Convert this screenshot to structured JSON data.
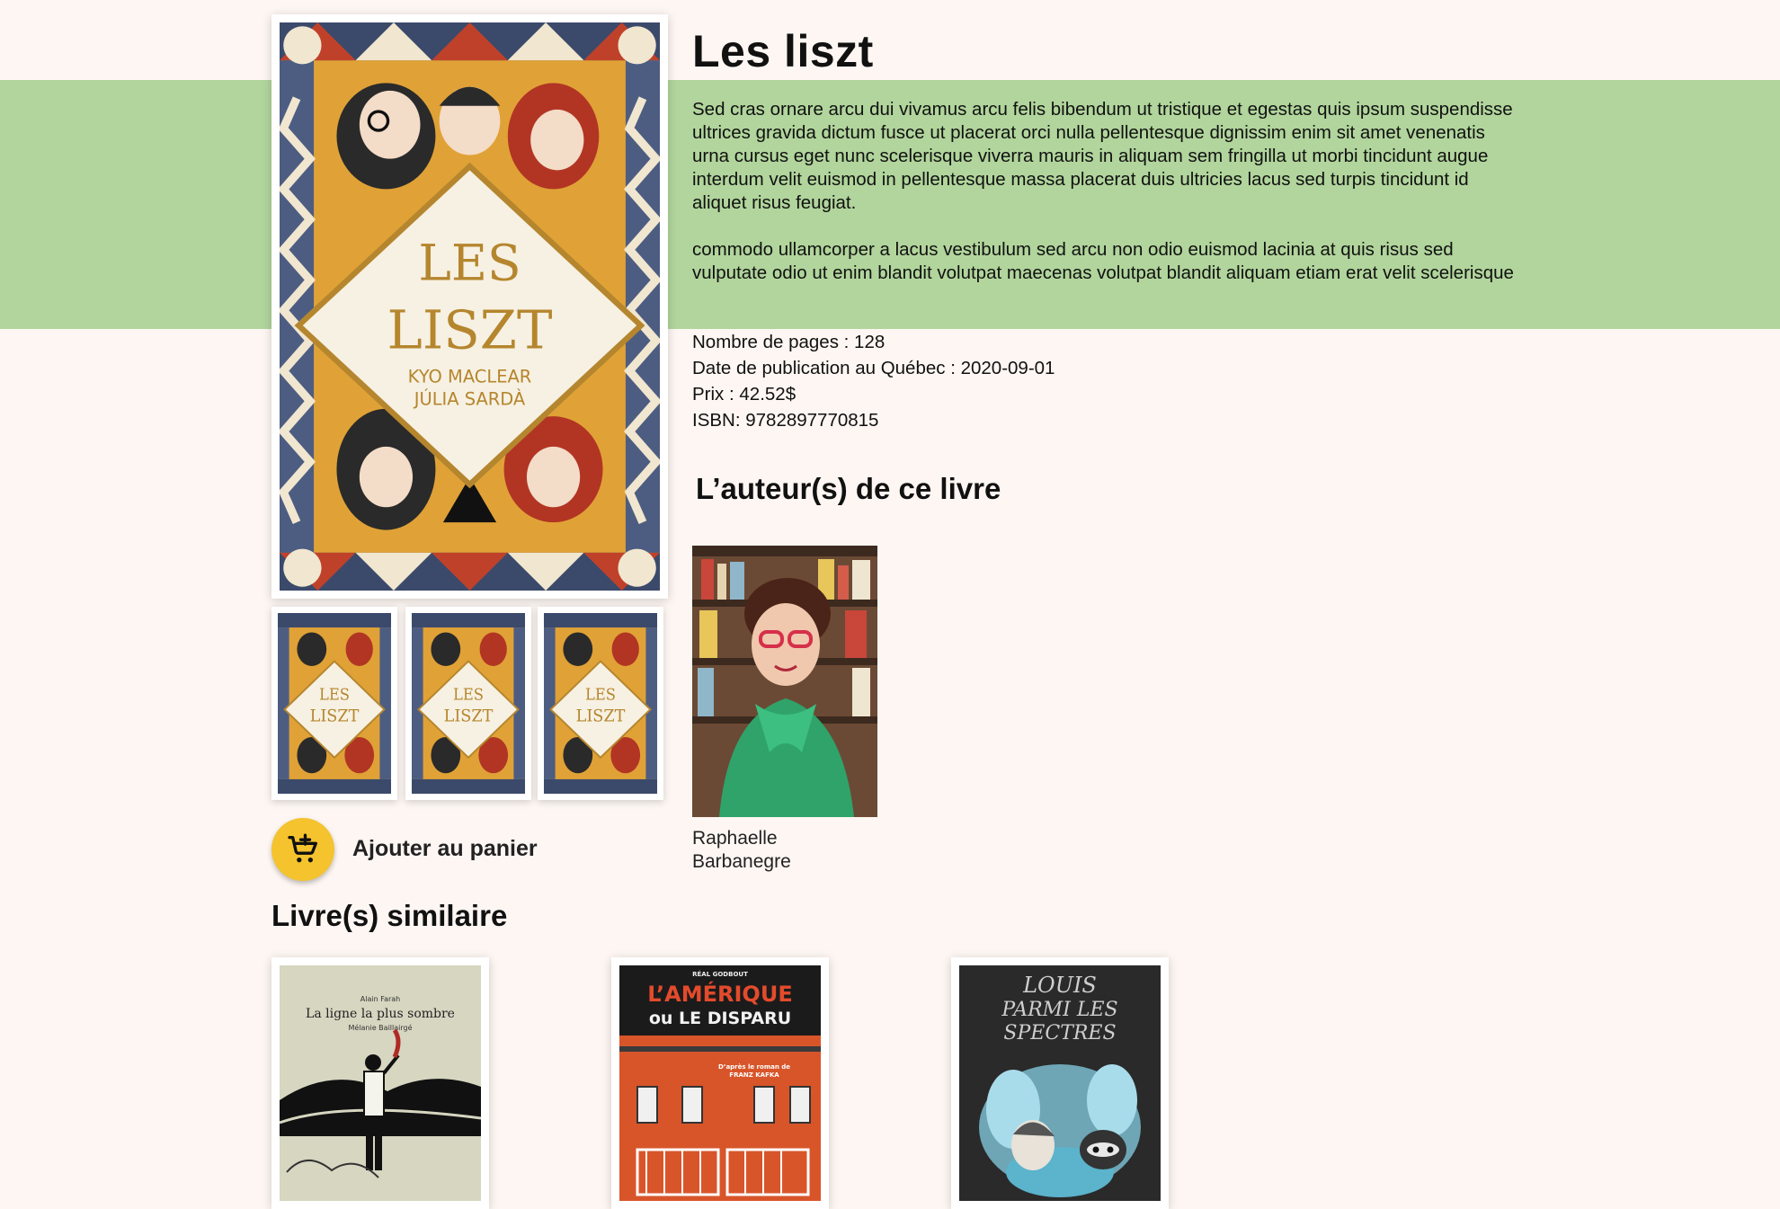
{
  "book": {
    "title": "Les liszt",
    "description": [
      "Sed cras ornare arcu dui vivamus arcu felis bibendum ut tristique et egestas quis ipsum suspendisse ultrices gravida dictum fusce ut placerat orci nulla pellentesque dignissim enim sit amet venenatis urna cursus eget nunc scelerisque viverra mauris in aliquam sem fringilla ut morbi tincidunt augue interdum velit euismod in pellentesque massa placerat duis ultricies lacus sed turpis tincidunt id aliquet risus feugiat.",
      "commodo ullamcorper a lacus vestibulum sed arcu non odio euismod lacinia at quis risus sed vulputate odio ut enim blandit volutpat maecenas volutpat blandit aliquam etiam erat velit scelerisque"
    ],
    "pages": "Nombre de pages : 128",
    "publication": "Date de publication au Québec : 2020-09-01",
    "price": "Prix : 42.52$",
    "isbn": "ISBN: 9782897770815",
    "cover": {
      "line1": "LES",
      "line2": "LISZT",
      "author1": "KYO MACLEAR",
      "author2": "JÚLIA SARDÀ"
    }
  },
  "cart": {
    "label": "Ajouter au panier",
    "icon": "cart-plus-icon",
    "color": "#f4c32e"
  },
  "authors": {
    "heading": "L’auteur(s) de ce livre",
    "items": [
      {
        "name": "Raphaelle Barbanegre"
      }
    ]
  },
  "similar": {
    "heading": "Livre(s) similaire",
    "books": [
      {
        "author": "Alain Farah",
        "title": "La ligne la plus sombre",
        "illustrator": "Mélanie Baillairgé"
      },
      {
        "publisher": "RÉAL GODBOUT",
        "title1": "L’AMÉRIQUE",
        "title2": "ou LE DISPARU",
        "subtitle1": "D’après le roman de",
        "subtitle2": "FRANZ KAFKA"
      },
      {
        "title1": "LOUIS",
        "title2": "PARMI LES",
        "title3": "SPECTRES"
      }
    ]
  },
  "colors": {
    "background": "#fdf6f2",
    "band": "#b1d59c",
    "accent": "#f4c32e"
  }
}
